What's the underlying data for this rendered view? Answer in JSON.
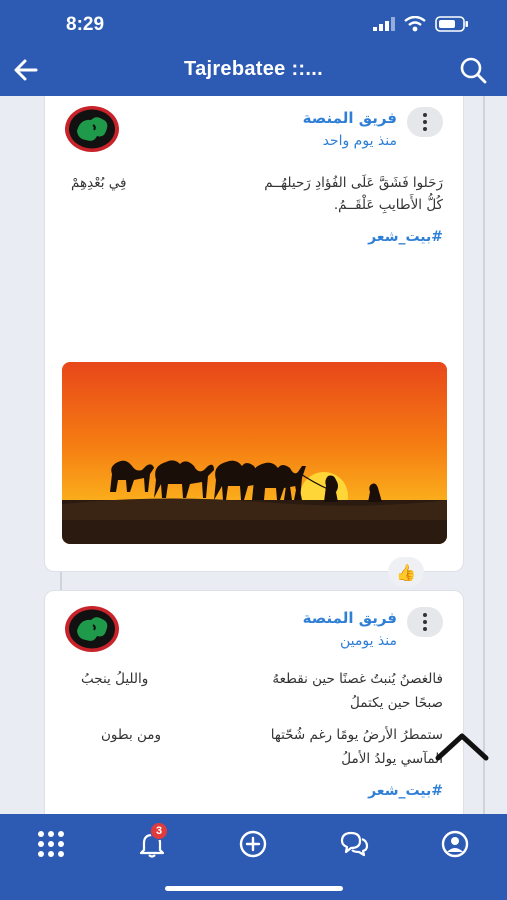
{
  "status_bar": {
    "time": "8:29"
  },
  "header": {
    "title": "Tajrebatee ::..."
  },
  "posts": [
    {
      "author": "فريق المنصة",
      "time_ago": "منذ يوم واحد",
      "verse_right_1": "رَحَلوا فَشَقَّ عَلَى الفُؤادِ رَحيلهُــم",
      "verse_right_2": "كُلُّ الأَطايبِ عَلْقَــمُ.",
      "verse_left_1": "فِي بُعْدِهِمْ",
      "hashtag": "#بيت_شعر"
    },
    {
      "author": "فريق المنصة",
      "time_ago": "منذ يومين",
      "verse_right_1": "فالغصنُ يُنبتُ غصنًا حين نقطعهُ",
      "verse_left_1": "والليلُ ينجبُ",
      "verse_right_2": "صبحًا حين يكتملُ",
      "verse_right_3": "ستمطرُ الأرضُ يومًا رغم شُحّتها",
      "verse_left_2": "ومن بطون",
      "verse_right_4": "المآسي يولدُ الأملُ",
      "hashtag": "#بيت_شعر"
    }
  ],
  "bottom_nav": {
    "notifications_badge": "3"
  },
  "colors": {
    "brand": "#2d5bb4",
    "link": "#2f7fd6",
    "badge": "#e23b3b"
  },
  "icons": [
    "back-arrow-icon",
    "search-icon",
    "kebab-menu-icon",
    "thumbs-up-icon",
    "share-icon",
    "comment-icon",
    "apps-grid-icon",
    "bell-icon",
    "plus-circle-icon",
    "chat-bubbles-icon",
    "profile-icon",
    "chevron-up-icon"
  ]
}
